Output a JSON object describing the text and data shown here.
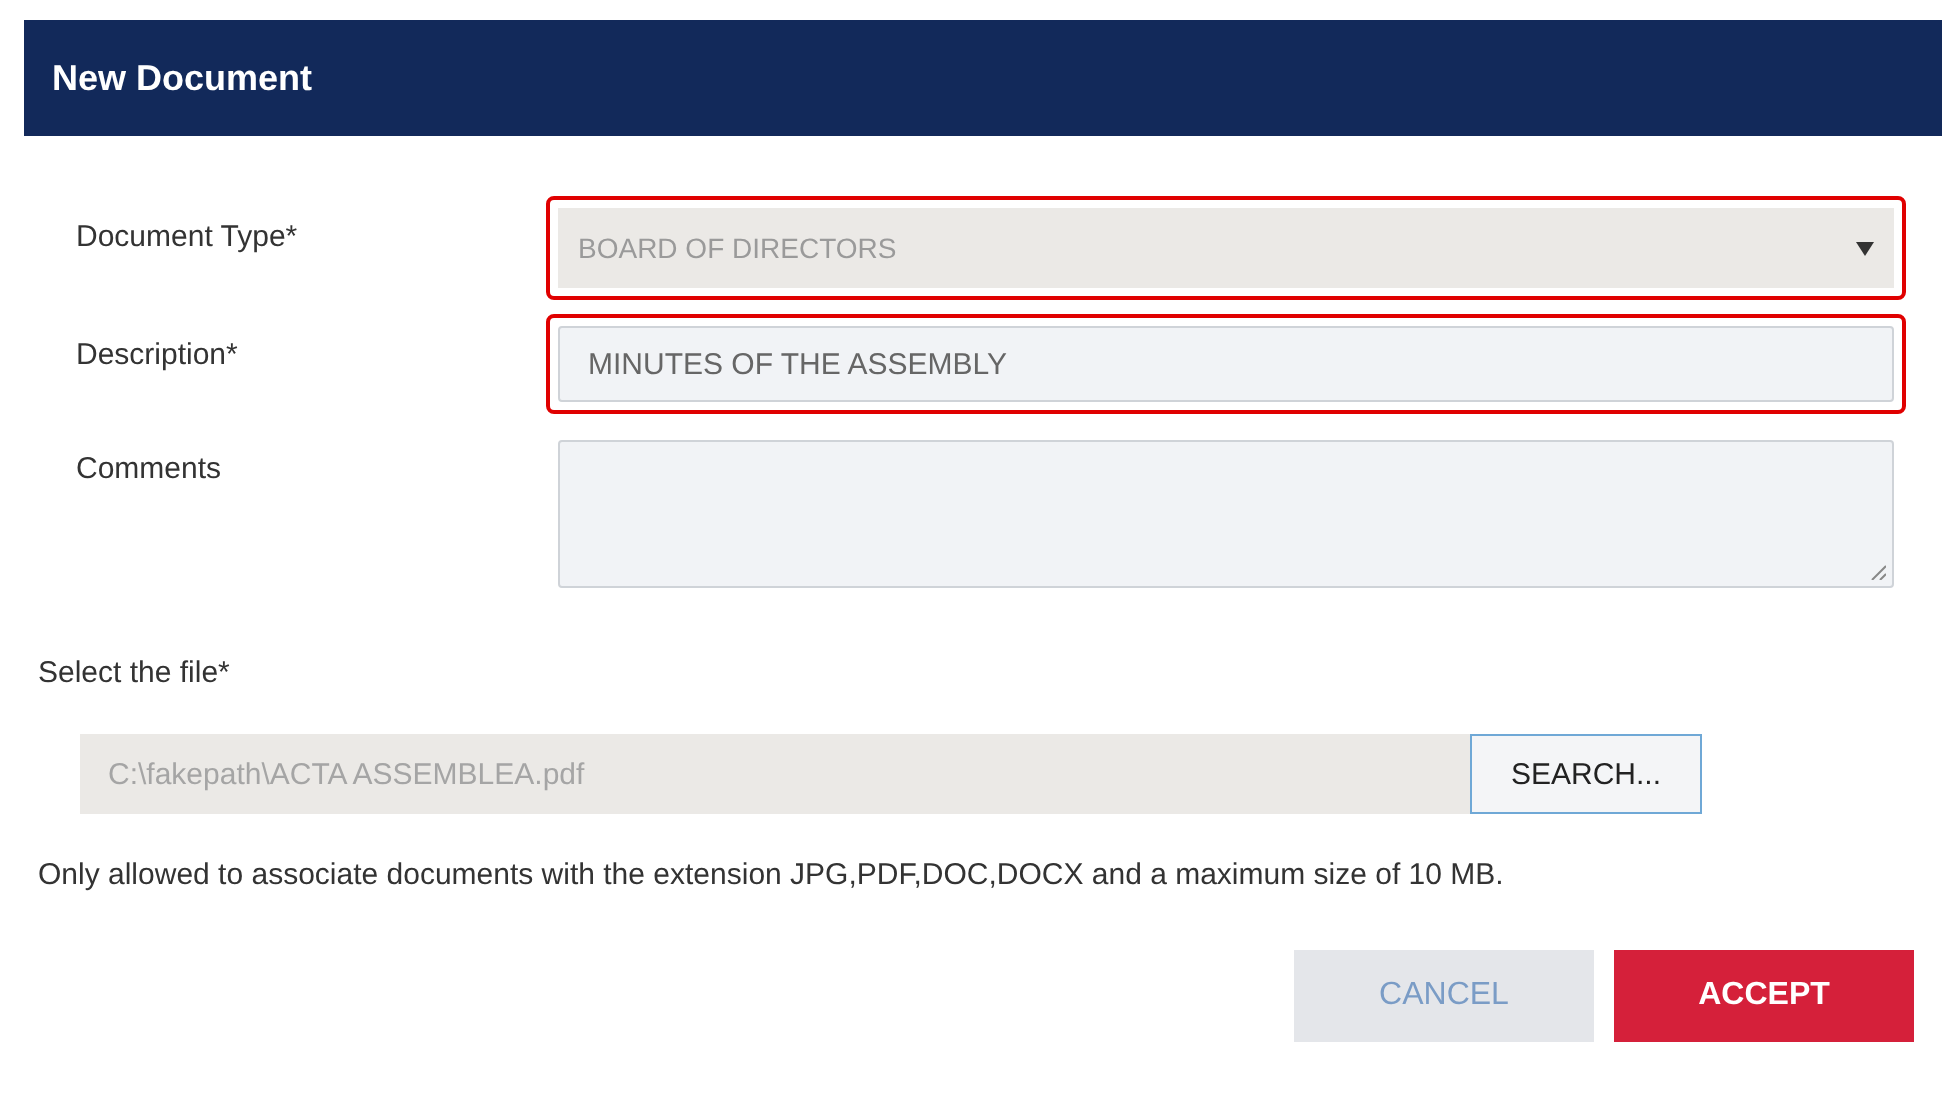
{
  "dialog": {
    "title": "New Document"
  },
  "fields": [
    {
      "kind": "select",
      "label": "Document Type*",
      "value": "BOARD OF DIRECTORS",
      "invalid": true,
      "disabled": true
    },
    {
      "kind": "text",
      "label": "Description*",
      "value": "MINUTES OF THE ASSEMBLY",
      "invalid": true,
      "disabled": false
    },
    {
      "kind": "textarea",
      "label": "Comments",
      "invalid": false,
      "disabled": false
    }
  ],
  "file": {
    "label": "Select the file*",
    "value": "C:\\fakepath\\ACTA ASSEMBLEA.pdf",
    "button": "SEARCH..."
  },
  "note": "Only allowed to associate documents with the extension JPG,PDF,DOC,DOCX and a maximum size of 10 MB.",
  "buttons": [
    {
      "kind": "secondary",
      "label": "CANCEL"
    },
    {
      "kind": "primary",
      "label": "ACCEPT"
    }
  ]
}
